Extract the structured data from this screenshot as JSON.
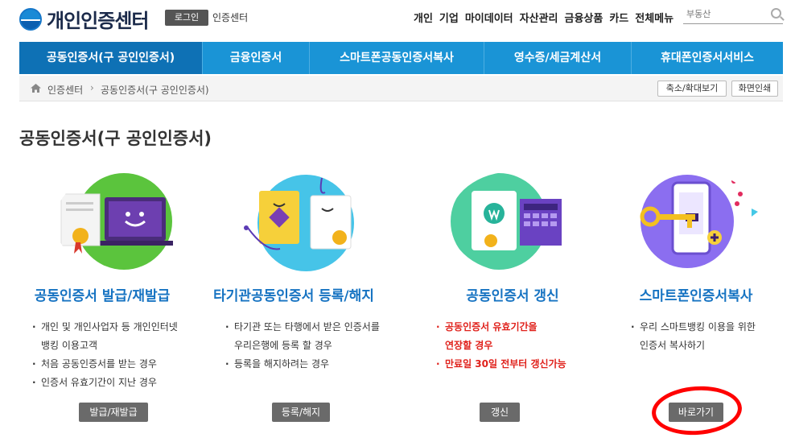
{
  "header": {
    "logo_text": "개인인증센터",
    "login_label": "로그인",
    "center_label": "인증센터",
    "nav": [
      "개인",
      "기업",
      "마이데이터",
      "자산관리",
      "금융상품",
      "카드",
      "전체메뉴"
    ],
    "search_placeholder": "부동산"
  },
  "menu": {
    "tabs": [
      "공동인증서(구 공인인증서)",
      "금융인증서",
      "스마트폰공동인증서복사",
      "영수증/세금계산서",
      "휴대폰인증서서비스"
    ],
    "active_index": 0
  },
  "breadcrumb": {
    "items": [
      "인증센터",
      "공동인증서(구 공인인증서)"
    ],
    "zoom_label": "축소/확대보기",
    "print_label": "화면인쇄"
  },
  "page_title": "공동인증서(구 공인인증서)",
  "cards": [
    {
      "title": "공동인증서 발급/재발급",
      "lines": [
        "개인 및 개인사업자 등 개인인터넷",
        "뱅킹 이용고객",
        "처음 공동인증서를 받는 경우",
        "인증서 유효기간이 지난 경우"
      ],
      "button": "발급/재발급"
    },
    {
      "title": "타기관공동인증서 등록/해지",
      "lines": [
        "타기관 또는 타행에서 받은 인증서를",
        "우리은행에 등록 할 경우",
        "등록을 해지하려는 경우"
      ],
      "button": "등록/해지"
    },
    {
      "title": "공동인증서 갱신",
      "lines": [
        "공동인증서 유효기간을",
        "연장할 경우",
        "만료일 30일 전부터 갱신가능"
      ],
      "button": "갱신"
    },
    {
      "title": "스마트폰인증서복사",
      "lines": [
        "우리 스마트뱅킹 이용을 위한",
        "인증서 복사하기"
      ],
      "button": "바로가기"
    }
  ],
  "colors": {
    "menu_blue": "#1a94d6",
    "menu_active": "#0e71b5",
    "title_blue": "#1673c2",
    "highlight_red": "#e0211b",
    "annotation_red": "#ff0000"
  }
}
